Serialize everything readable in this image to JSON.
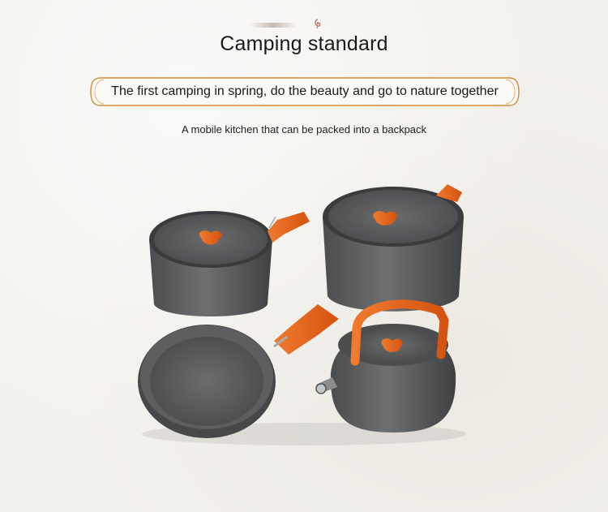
{
  "header": {
    "title": "Camping standard",
    "banner_text": "The first camping in spring, do the beauty and go to nature together",
    "subtitle": "A mobile kitchen that can be packed into a backpack"
  },
  "colors": {
    "background": "#f3f1ed",
    "banner_border": "#c98b3a",
    "handle_orange": "#e8641c",
    "pot_gray": "#5b5d5f"
  },
  "icons": {
    "ornament": "brush-stroke-icon",
    "swirl": "swirl-icon"
  }
}
